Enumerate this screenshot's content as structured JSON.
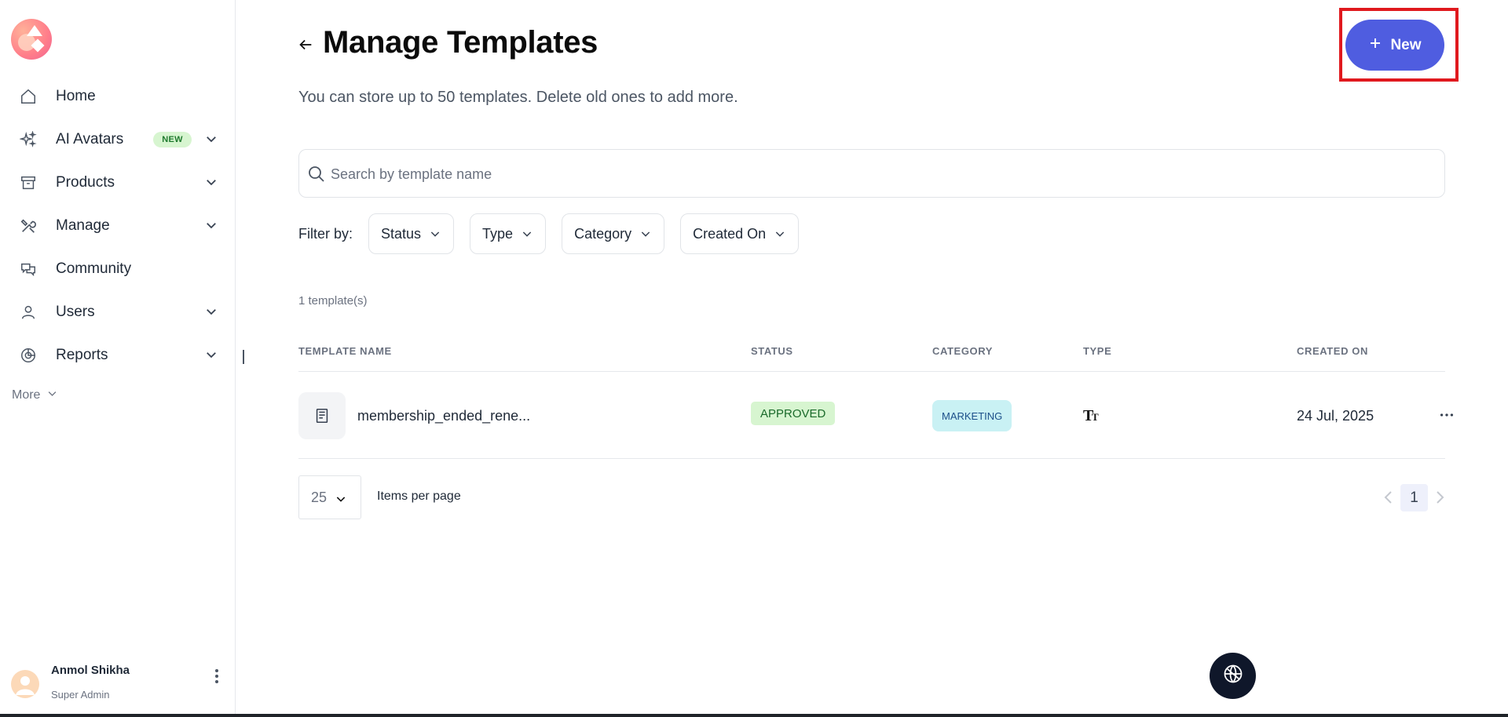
{
  "sidebar": {
    "items": [
      {
        "label": "Home",
        "icon": "home-icon"
      },
      {
        "label": "AI Avatars",
        "icon": "sparkle-icon",
        "badge": "NEW"
      },
      {
        "label": "Products",
        "icon": "archive-box-icon"
      },
      {
        "label": "Manage",
        "icon": "tools-icon"
      },
      {
        "label": "Community",
        "icon": "chat-bubbles-icon"
      },
      {
        "label": "Users",
        "icon": "user-icon"
      },
      {
        "label": "Reports",
        "icon": "pie-chart-icon"
      }
    ],
    "more_label": "More",
    "user": {
      "name": "Anmol Shikha",
      "role": "Super Admin"
    }
  },
  "header": {
    "title": "Manage Templates",
    "subtitle": "You can store up to 50 templates. Delete old ones to add more.",
    "new_button_label": "New"
  },
  "search": {
    "placeholder": "Search by template name",
    "value": ""
  },
  "filters": {
    "label": "Filter by:",
    "options": [
      "Status",
      "Type",
      "Category",
      "Created On"
    ]
  },
  "count_text": "1 template(s)",
  "table": {
    "columns": [
      "TEMPLATE NAME",
      "STATUS",
      "CATEGORY",
      "TYPE",
      "CREATED ON"
    ],
    "rows": [
      {
        "name": "membership_ended_rene...",
        "status": "APPROVED",
        "category": "MARKETING",
        "type_icon": "text-type-icon",
        "created_on": "24 Jul, 2025"
      }
    ]
  },
  "pagination": {
    "page_size": "25",
    "items_per_page_label": "Items per page",
    "current_page": "1"
  },
  "colors": {
    "accent": "#4f5de0",
    "highlight": "#e0191e",
    "status_approved_bg": "#d7f5d0",
    "category_bg": "#c9f1f4",
    "fab_bg": "#0f172a"
  }
}
